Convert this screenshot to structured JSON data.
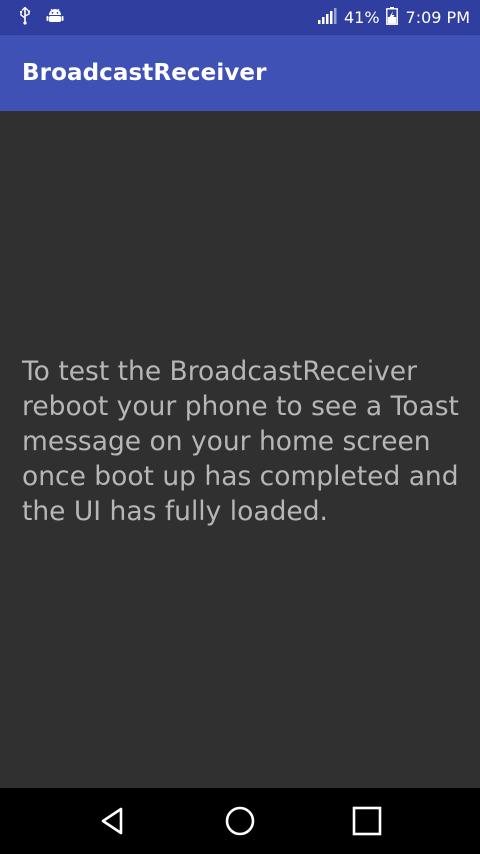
{
  "status_bar": {
    "battery_percent": "41%",
    "time": "7:09 PM",
    "icons": [
      "usb-icon",
      "android-debug-icon",
      "signal-icon",
      "battery-charging-icon"
    ]
  },
  "app_bar": {
    "title": "BroadcastReceiver"
  },
  "content": {
    "message": "To test the BroadcastReceiver reboot your phone to see a Toast message on your home screen once boot up has completed and the UI has fully loaded."
  },
  "nav_bar": {
    "buttons": [
      "back-icon",
      "home-icon",
      "recents-icon"
    ]
  },
  "colors": {
    "status_bar": "#303F9F",
    "app_bar": "#3F51B5",
    "background": "#303030",
    "text": "#b6b6b6"
  }
}
